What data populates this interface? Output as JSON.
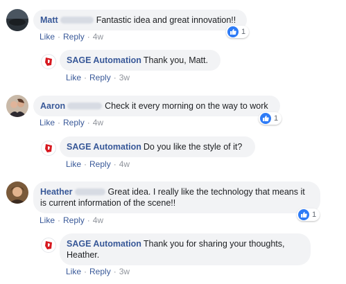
{
  "comments": [
    {
      "author": "Matt",
      "text": "Fantastic idea and great innovation!!",
      "actions": {
        "like": "Like",
        "reply": "Reply",
        "time": "4w"
      },
      "reaction_count": "1",
      "reply": {
        "author": "SAGE Automation",
        "text": "Thank you, Matt.",
        "actions": {
          "like": "Like",
          "reply": "Reply",
          "time": "3w"
        }
      }
    },
    {
      "author": "Aaron",
      "text": "Check it every morning on the way to work",
      "actions": {
        "like": "Like",
        "reply": "Reply",
        "time": "4w"
      },
      "reaction_count": "1",
      "reply": {
        "author": "SAGE Automation",
        "text": "Do you like the style of it?",
        "actions": {
          "like": "Like",
          "reply": "Reply",
          "time": "4w"
        }
      }
    },
    {
      "author": "Heather",
      "text": "Great idea. I really like the technology that means it is current information of the scene!!",
      "actions": {
        "like": "Like",
        "reply": "Reply",
        "time": "4w"
      },
      "reaction_count": "1",
      "reply": {
        "author": "SAGE Automation",
        "text": "Thank you for sharing your thoughts, Heather.",
        "actions": {
          "like": "Like",
          "reply": "Reply",
          "time": "3w"
        }
      }
    }
  ],
  "colors": {
    "link": "#385898",
    "bubble": "#f2f3f5",
    "like_blue": "#2e7bf6",
    "sage_red": "#d71920"
  }
}
